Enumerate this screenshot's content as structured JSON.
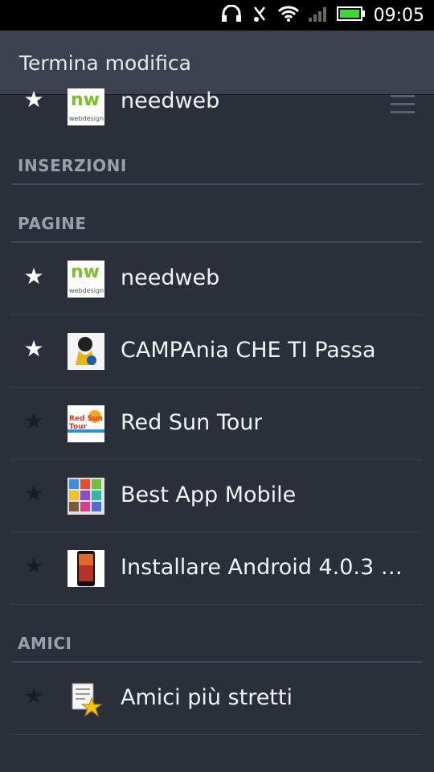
{
  "status_bar": {
    "time": "09:05",
    "icons": [
      "headphones-icon",
      "mute-icon",
      "wifi-icon",
      "signal-icon",
      "battery-icon"
    ]
  },
  "header": {
    "title": "Termina modifica"
  },
  "list": {
    "top_item": {
      "label": "needweb",
      "starred": true,
      "icon": "needweb-logo"
    },
    "sections": [
      {
        "title": "INSERZIONI",
        "items": []
      },
      {
        "title": "PAGINE",
        "items": [
          {
            "label": "needweb",
            "starred": true,
            "icon": "needweb-logo"
          },
          {
            "label": "CAMPAnia CHE TI Passa",
            "starred": true,
            "icon": "campania-logo"
          },
          {
            "label": "Red Sun Tour",
            "starred": false,
            "icon": "redsun-logo"
          },
          {
            "label": "Best App Mobile",
            "starred": false,
            "icon": "bestapp-logo"
          },
          {
            "label": "Installare Android 4.0.3 s…",
            "starred": false,
            "icon": "android-phone-logo"
          }
        ]
      },
      {
        "title": "AMICI",
        "items": [
          {
            "label": "Amici più stretti",
            "starred": false,
            "icon": "friends-list-icon"
          }
        ]
      }
    ]
  },
  "logos": {
    "needweb_text": "nw",
    "needweb_sub": "webdesign",
    "redsun_text": "Red Sun Tour"
  },
  "colors": {
    "background": "#2b2f3a",
    "header": "#3b414e",
    "star_on": "#ffffff",
    "star_off": "#1a1d24",
    "section_text": "#9aa0ab"
  }
}
